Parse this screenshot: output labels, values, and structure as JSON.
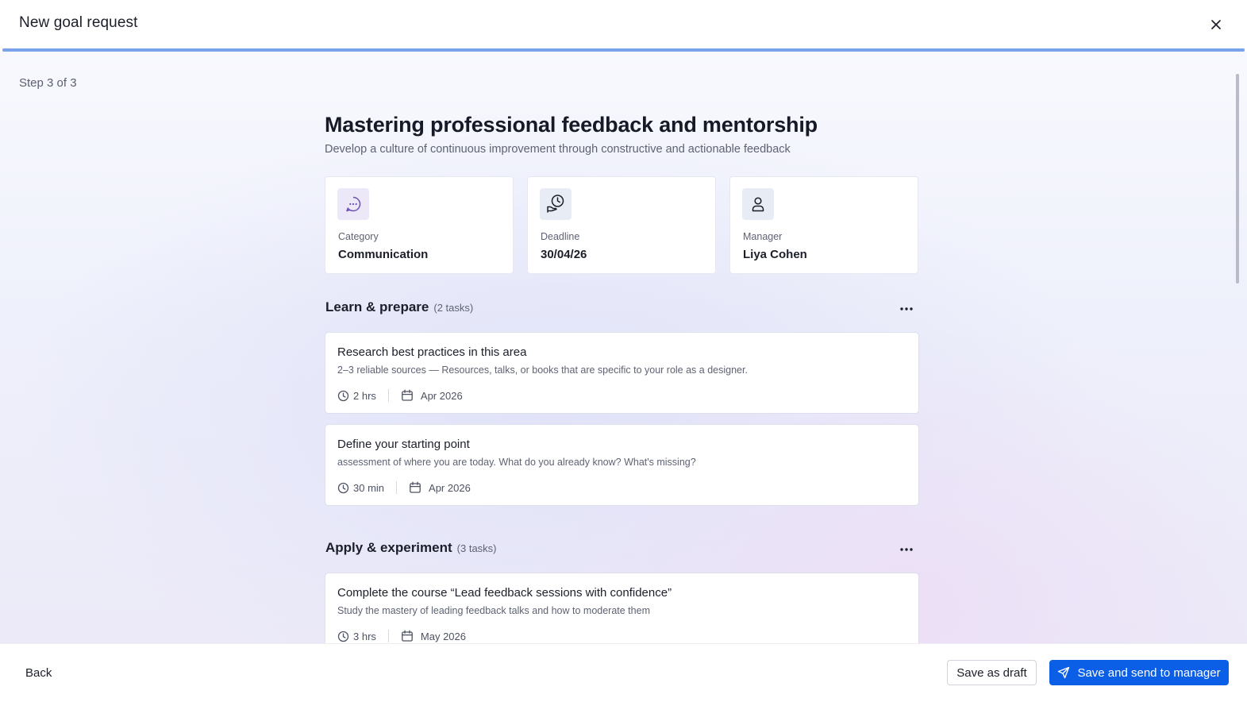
{
  "header": {
    "title": "New goal request",
    "close_icon": "close-icon"
  },
  "progress": {
    "fraction": 1.0
  },
  "step_label": "Step 3 of 3",
  "goal": {
    "title": "Mastering professional feedback and mentorship",
    "subtitle": "Develop a culture of continuous improvement through constructive and actionable feedback"
  },
  "info_cards": [
    {
      "icon": "chat-bubble-icon",
      "label": "Category",
      "value": "Communication",
      "icon_bg": "#ede8f7",
      "icon_color": "#6b4fb8"
    },
    {
      "icon": "clock-hand-icon",
      "label": "Deadline",
      "value": "30/04/26",
      "icon_bg": "#e8ecf5",
      "icon_color": "#1c1f2a"
    },
    {
      "icon": "user-icon",
      "label": "Manager",
      "value": "Liya Cohen",
      "icon_bg": "#e8ecf5",
      "icon_color": "#1c1f2a"
    }
  ],
  "sections": [
    {
      "title": "Learn & prepare",
      "count": "(2 tasks)",
      "tasks": [
        {
          "title": "Research best practices in this area",
          "description": "2–3 reliable sources — Resources, talks, or books that are specific to your role as a designer.",
          "duration": "2 hrs",
          "date": "Apr 2026"
        },
        {
          "title": "Define your starting point",
          "description": "assessment of where you are today. What do you already know? What's missing?",
          "duration": "30 min",
          "date": "Apr 2026"
        }
      ]
    },
    {
      "title": "Apply & experiment",
      "count": "(3 tasks)",
      "tasks": [
        {
          "title": "Complete the course “Lead feedback sessions with confidence”",
          "description": "Study the mastery of leading feedback talks and how to moderate them",
          "duration": "3 hrs",
          "date": "May 2026"
        }
      ]
    }
  ],
  "footer": {
    "back_label": "Back",
    "draft_label": "Save as draft",
    "send_label": "Save and send to manager"
  },
  "colors": {
    "primary": "#0b5ee6",
    "progress": "#7aa3ec"
  }
}
